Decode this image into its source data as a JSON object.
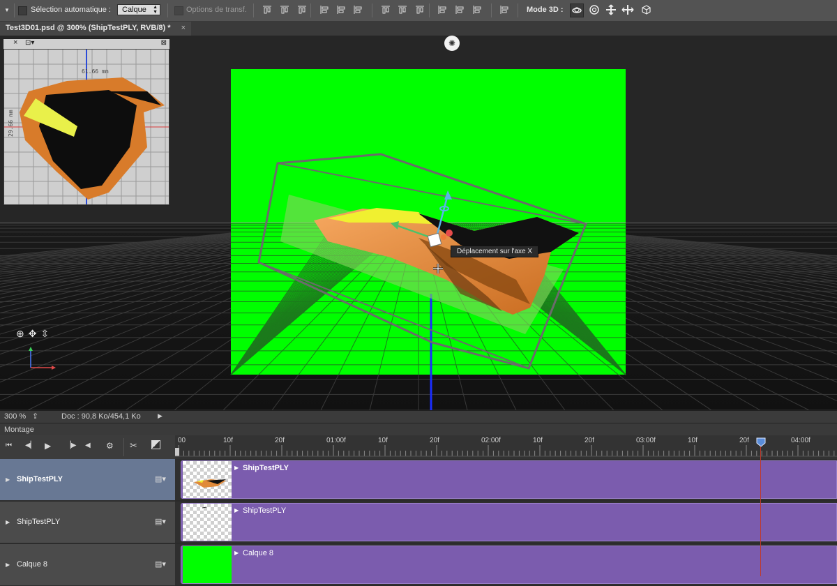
{
  "options_bar": {
    "auto_select_label": "Sélection automatique :",
    "auto_select_value": "Calque",
    "transform_options_label": "Options de transf.",
    "mode3d_label": "Mode 3D :"
  },
  "document": {
    "tab_title": "Test3D01.psd @ 300% (ShipTestPLY, RVB/8) *",
    "close_glyph": "×"
  },
  "minimap": {
    "width_readout": "61.66 mm",
    "height_readout": "29.66 mm"
  },
  "canvas": {
    "tooltip": "Déplacement sur l'axe X",
    "bg_color": "#00ff00"
  },
  "status_bar": {
    "zoom": "300 %",
    "doc_info": "Doc : 90,8 Ko/454,1 Ko"
  },
  "timeline": {
    "panel_title": "Montage",
    "ruler_labels": [
      "00",
      "10f",
      "20f",
      "01:00f",
      "10f",
      "20f",
      "02:00f",
      "10f",
      "20f",
      "03:00f",
      "10f",
      "20f",
      "04:00f"
    ],
    "layers": [
      {
        "name": "ShipTestPLY",
        "clip_title": "ShipTestPLY",
        "selected": true
      },
      {
        "name": "ShipTestPLY",
        "clip_title": "ShipTestPLY",
        "selected": false
      },
      {
        "name": "Calque 8",
        "clip_title": "Calque 8",
        "selected": false
      }
    ],
    "clip_color": "#7b5cae",
    "playhead_color": "#c0392b"
  },
  "icons": [
    "tool-preset-icon",
    "align-icon",
    "orbit-3d-icon",
    "roll-3d-icon",
    "pan-3d-icon",
    "slide-3d-icon",
    "scale-3d-icon",
    "play-icon",
    "scissors-icon",
    "gear-icon"
  ]
}
